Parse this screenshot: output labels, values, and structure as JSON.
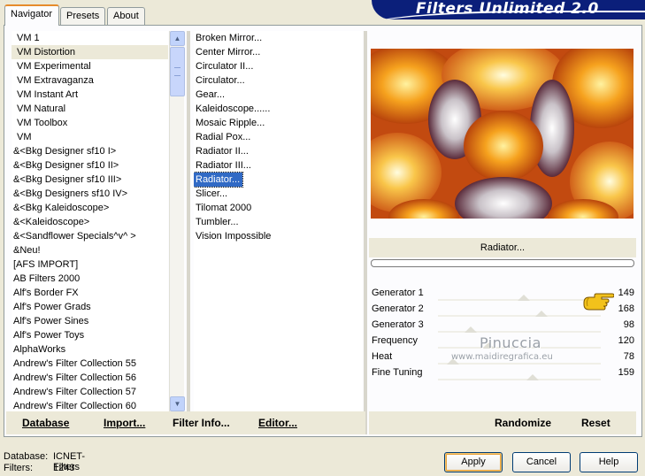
{
  "tabs": [
    "Navigator",
    "Presets",
    "About"
  ],
  "app_title": "Filters Unlimited 2.0",
  "categories": [
    "VM 1",
    "VM Distortion",
    "VM Experimental",
    "VM Extravaganza",
    "VM Instant Art",
    "VM Natural",
    "VM Toolbox",
    "VM",
    "&<Bkg Designer sf10 I>",
    "&<Bkg Designer sf10 II>",
    "&<Bkg Designer sf10 III>",
    "&<Bkg Designers sf10 IV>",
    "&<Bkg Kaleidoscope>",
    "&<Kaleidoscope>",
    "&<Sandflower Specials^v^ >",
    "&Neu!",
    "[AFS IMPORT]",
    "AB Filters 2000",
    "Alf's Border FX",
    "Alf's Power Grads",
    "Alf's Power Sines",
    "Alf's Power Toys",
    "AlphaWorks",
    "Andrew's Filter Collection 55",
    "Andrew's Filter Collection 56",
    "Andrew's Filter Collection 57",
    "Andrew's Filter Collection 60"
  ],
  "filters": [
    "Broken Mirror...",
    "Center Mirror...",
    "Circulator II...",
    "Circulator...",
    "Gear...",
    "Kaleidoscope......",
    "Mosaic Ripple...",
    "Radial Pox...",
    "Radiator II...",
    "Radiator III...",
    "Radiator...",
    "Slicer...",
    "Tilomat 2000",
    "Tumbler...",
    "Vision Impossible"
  ],
  "selected_filter": "Radiator...",
  "params": [
    {
      "name": "Generator 1",
      "value": "149"
    },
    {
      "name": "Generator 2",
      "value": "168"
    },
    {
      "name": "Generator 3",
      "value": "98"
    },
    {
      "name": "Frequency",
      "value": "120"
    },
    {
      "name": "Heat",
      "value": "78"
    },
    {
      "name": "Fine Tuning",
      "value": "159"
    }
  ],
  "left_buttons": {
    "database": "Database",
    "import": "Import...",
    "filter_info": "Filter Info...",
    "editor": "Editor..."
  },
  "right_buttons": {
    "randomize": "Randomize",
    "reset": "Reset"
  },
  "status": {
    "db_label": "Database:",
    "db_value": "ICNET-Filters",
    "filters_label": "Filters:",
    "filters_value": "1243"
  },
  "dialog_buttons": {
    "apply": "Apply",
    "cancel": "Cancel",
    "help": "Help"
  },
  "watermark": {
    "name": "Pinuccia",
    "url": "www.maidiregrafica.eu"
  },
  "colors": {
    "selection": "#316ac5",
    "banner": "#0b1f7a",
    "accent_tab": "#e68b2c"
  }
}
